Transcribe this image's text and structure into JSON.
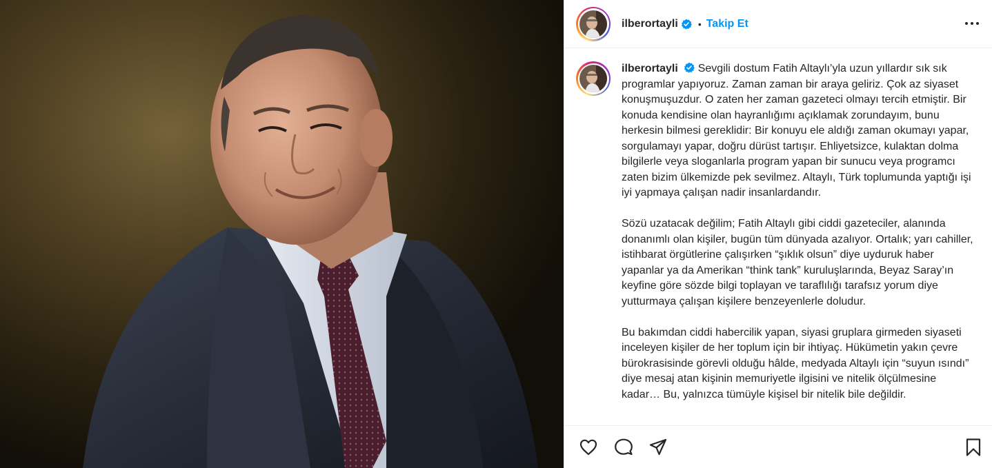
{
  "header": {
    "username": "ilberortayli",
    "verified_icon": "verified-badge-icon",
    "separator": "•",
    "follow_label": "Takip Et",
    "more_icon": "more-options-icon"
  },
  "caption": {
    "username": "ilberortayli",
    "paragraphs": [
      "Sevgili dostum Fatih Altaylı’yla uzun yıllardır sık sık programlar yapıyoruz. Zaman zaman bir araya geliriz. Çok az siyaset konuşmuşuzdur. O zaten her zaman gazeteci olmayı tercih etmiştir. Bir konuda kendisine olan hayranlığımı açıklamak zorundayım, bunu herkesin bilmesi gereklidir: Bir konuyu ele aldığı zaman okumayı yapar, sorgulamayı yapar, doğru dürüst tartışır. Ehliyetsizce, kulaktan dolma bilgilerle veya sloganlarla program yapan bir sunucu veya programcı zaten bizim ülkemizde pek sevilmez. Altaylı, Türk toplumunda yaptığı işi iyi yapmaya çalışan nadir insanlardandır.",
      "Sözü uzatacak değilim; Fatih Altaylı gibi ciddi gazeteciler, alanında donanımlı olan kişiler, bugün tüm dünyada azalıyor. Ortalık; yarı cahiller, istihbarat örgütlerine çalışırken “şıklık olsun” diye uyduruk haber yapanlar ya da Amerikan “think tank” kuruluşlarında, Beyaz Saray’ın keyfine göre sözde bilgi toplayan ve taraflılığı tarafsız yorum diye yutturmaya çalışan kişilere benzeyenlerle doludur.",
      "Bu bakımdan ciddi habercilik yapan, siyasi gruplara girmeden siyaseti inceleyen kişiler de her toplum için bir ihtiyaç. Hükümetin yakın çevre bürokrasisinde görevli olduğu hâlde, medyada Altaylı için “suyun ısındı” diye mesaj atan kişinin memuriyetle ilgisini ve nitelik ölçülmesine kadar… Bu, yalnızca tümüyle kişisel bir nitelik bile değildir."
    ]
  },
  "actions": {
    "like_icon": "heart-icon",
    "comment_icon": "comment-icon",
    "share_icon": "share-icon",
    "save_icon": "bookmark-icon"
  },
  "colors": {
    "link_blue": "#0095f6",
    "text": "#262626",
    "border": "#efefef"
  }
}
